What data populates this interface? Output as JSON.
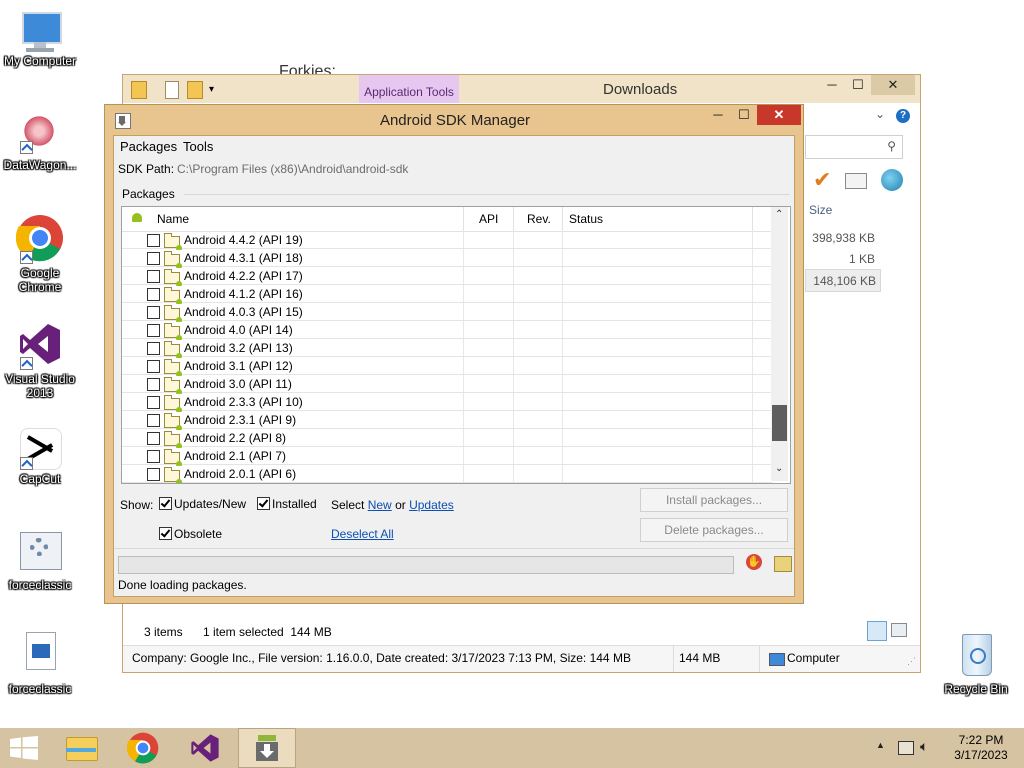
{
  "desktop": {
    "icons": [
      {
        "label": "My Computer"
      },
      {
        "label": "DataWagon..."
      },
      {
        "label": "Google Chrome"
      },
      {
        "label": "Visual Studio 2013"
      },
      {
        "label": "CapCut"
      },
      {
        "label": "forceclassic"
      },
      {
        "label": "forceclassic"
      },
      {
        "label": "Recycle Bin"
      }
    ],
    "behind_text": "Forkies:"
  },
  "explorer": {
    "contextual_tab": "Application Tools",
    "title": "Downloads",
    "size_header": "Size",
    "sizes": [
      "398,938 KB",
      "1 KB",
      "148,106 KB"
    ],
    "status_items": "3 items",
    "status_selected": "1 item selected  144 MB",
    "details_bar": "Company: Google Inc., File version: 1.16.0.0, Date created: 3/17/2023 7:13 PM, Size: 144 MB",
    "details_size": "144 MB",
    "details_location": "Computer"
  },
  "sdk": {
    "title": "Android SDK Manager",
    "menu": [
      "Packages",
      "Tools"
    ],
    "path_label": "SDK Path:",
    "path_value": "C:\\Program Files (x86)\\Android\\android-sdk",
    "packages_group": "Packages",
    "columns": {
      "name": "Name",
      "api": "API",
      "rev": "Rev.",
      "status": "Status"
    },
    "packages": [
      "Android 4.4.2 (API 19)",
      "Android 4.3.1 (API 18)",
      "Android 4.2.2 (API 17)",
      "Android 4.1.2 (API 16)",
      "Android 4.0.3 (API 15)",
      "Android 4.0 (API 14)",
      "Android 3.2 (API 13)",
      "Android 3.1 (API 12)",
      "Android 3.0 (API 11)",
      "Android 2.3.3 (API 10)",
      "Android 2.3.1 (API 9)",
      "Android 2.2 (API 8)",
      "Android 2.1 (API 7)",
      "Android 2.0.1 (API 6)"
    ],
    "show_label": "Show:",
    "filters": {
      "updates_new": "Updates/New",
      "installed": "Installed",
      "obsolete": "Obsolete"
    },
    "select_label": "Select",
    "select_new": "New",
    "select_or": "or",
    "select_updates": "Updates",
    "deselect_all": "Deselect All",
    "install_button": "Install packages...",
    "delete_button": "Delete packages...",
    "status": "Done loading packages."
  },
  "taskbar": {
    "time": "7:22 PM",
    "date": "3/17/2023"
  }
}
